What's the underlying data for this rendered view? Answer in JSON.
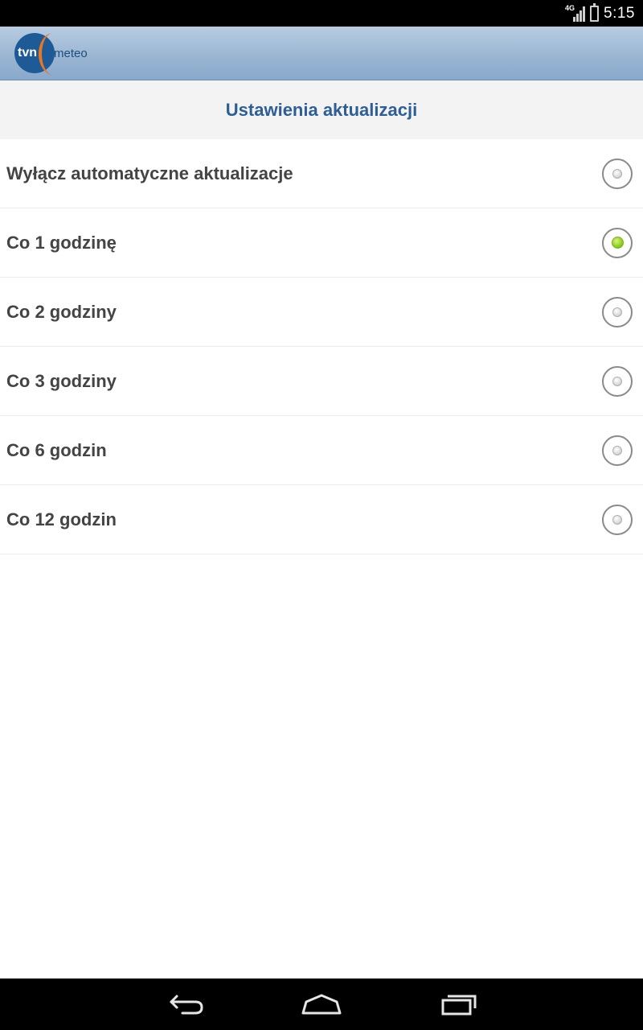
{
  "status_bar": {
    "network": "4G",
    "time": "5:15",
    "icons": [
      "signal-icon",
      "battery-icon"
    ]
  },
  "app_bar": {
    "logo_tvn": "tvn",
    "logo_meteo": "meteo",
    "colors": {
      "logo_blue": "#1e5a96",
      "logo_orange": "#e87722"
    }
  },
  "page": {
    "title": "Ustawienia aktualizacji"
  },
  "options": [
    {
      "label": "Wyłącz automatyczne aktualizacje",
      "selected": false
    },
    {
      "label": "Co 1 godzinę",
      "selected": true
    },
    {
      "label": "Co 2 godziny",
      "selected": false
    },
    {
      "label": "Co 3 godziny",
      "selected": false
    },
    {
      "label": "Co 6 godzin",
      "selected": false
    },
    {
      "label": "Co 12 godzin",
      "selected": false
    }
  ],
  "nav_bar": {
    "icons": [
      "back-icon",
      "home-icon",
      "recents-icon"
    ]
  },
  "colors": {
    "title": "#2e5e93",
    "selected_radio": "#8fcc20"
  }
}
